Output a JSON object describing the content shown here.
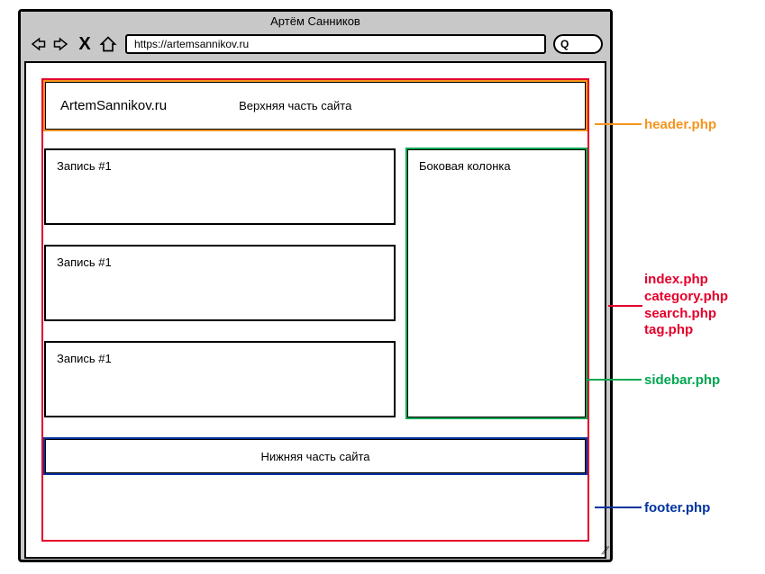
{
  "browser": {
    "title": "Артём Санников",
    "url": "https://artemsannikov.ru",
    "search_glyph": "Q"
  },
  "header": {
    "site_name": "ArtemSannikov.ru",
    "label": "Верхняя часть сайта"
  },
  "posts": [
    {
      "title": "Запись #1"
    },
    {
      "title": "Запись #1"
    },
    {
      "title": "Запись #1"
    }
  ],
  "sidebar": {
    "label": "Боковая колонка"
  },
  "footer": {
    "label": "Нижняя часть сайта"
  },
  "annotations": {
    "header": "header.php",
    "index": "index.php\ncategory.php\nsearch.php\ntag.php",
    "sidebar": "sidebar.php",
    "footer": "footer.php"
  },
  "colors": {
    "header": "#f7941d",
    "index": "#e4002b",
    "sidebar": "#00a651",
    "footer": "#0033a0"
  }
}
